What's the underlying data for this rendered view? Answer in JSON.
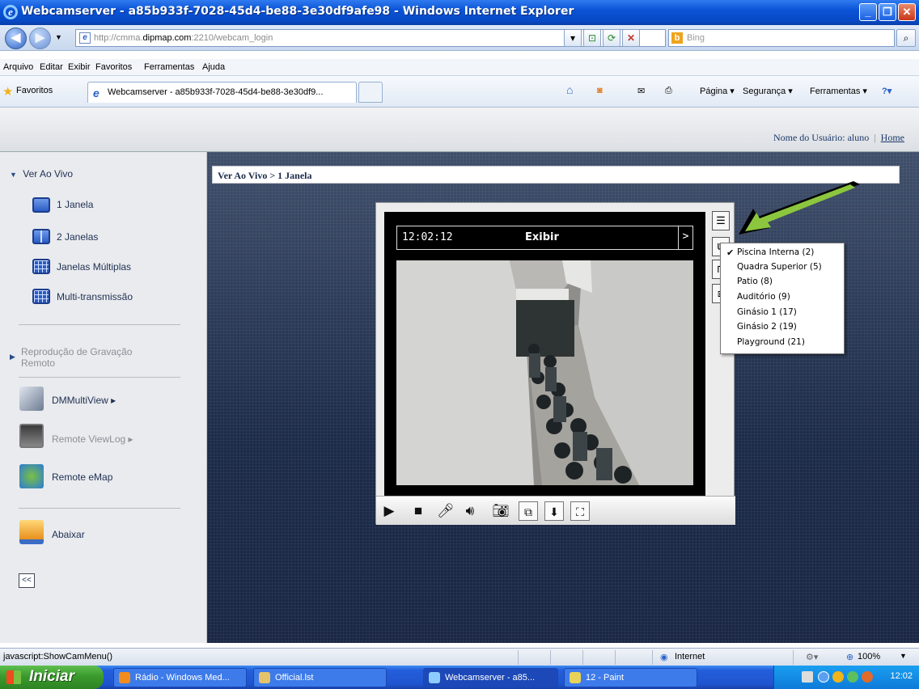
{
  "window": {
    "title": "Webcamserver - a85b933f-7028-45d4-be88-3e30df9afe98 - Windows Internet Explorer",
    "min": "_",
    "max": "❐",
    "close": "✕"
  },
  "address": {
    "url_prefix": "http://cmma.",
    "url_domain": "dipmap.com",
    "url_suffix": ":2210/webcam_login",
    "search_placeholder": "Bing"
  },
  "menu": [
    "Arquivo",
    "Editar",
    "Exibir",
    "Favoritos",
    "Ferramentas",
    "Ajuda"
  ],
  "favorites": {
    "label": "Favoritos",
    "tab_title": "Webcamserver - a85b933f-7028-45d4-be88-3e30df9...",
    "cmd_pagina": "Página ▾",
    "cmd_seguranca": "Segurança ▾",
    "cmd_ferramentas": "Ferramentas ▾"
  },
  "header": {
    "user_label": "Nome do Usuário: aluno",
    "separator": "|",
    "home": "Home"
  },
  "sidebar": {
    "section_live": "Ver Ao Vivo",
    "items": [
      "1 Janela",
      "2 Janelas",
      "Janelas Múltiplas",
      "Multi-transmissão"
    ],
    "playback": "Reprodução de Gravação Remoto",
    "dmmultiview": "DMMultiView ▸",
    "viewlog": "Remote ViewLog ▸",
    "emap": "Remote eMap",
    "download": "Abaixar",
    "collapse": "<<"
  },
  "content": {
    "breadcrumb": "Ver Ao Vivo > 1 Janela",
    "video_time": "12:02:12",
    "video_label": "Exibir",
    "video_arrow": ">"
  },
  "cam_menu": {
    "options": [
      "Piscina Interna (2)",
      "Quadra Superior (5)",
      "Patio (8)",
      "Auditório (9)",
      "Ginásio 1 (17)",
      "Ginásio 2 (19)",
      "Playground (21)"
    ],
    "selected_index": 0,
    "check": "✔"
  },
  "status": {
    "text": "javascript:ShowCamMenu()",
    "zone": "Internet",
    "zoom": "100%"
  },
  "taskbar": {
    "start": "Iniciar",
    "tasks": [
      "Rádio - Windows Med...",
      "Official.lst",
      "Webcamserver - a85...",
      "12 - Paint"
    ],
    "clock": "12:02"
  },
  "colors": {
    "titlebar": "#0a53d6",
    "arrow": "#8cc63f",
    "content_bg": "#233454"
  }
}
